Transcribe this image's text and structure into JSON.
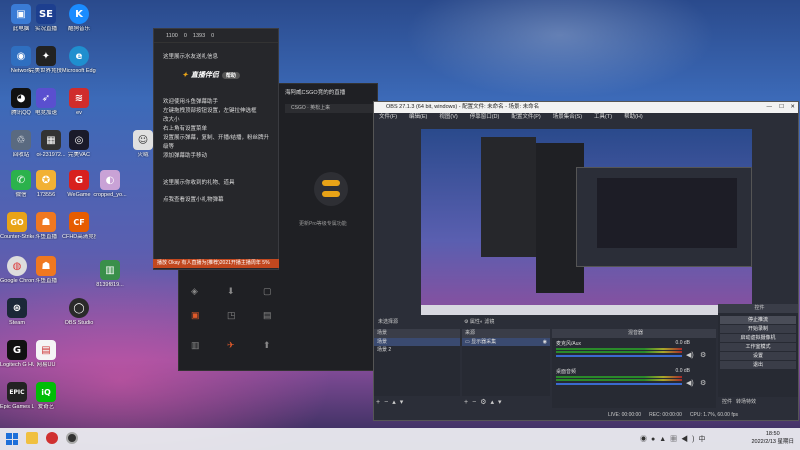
{
  "desktop": {
    "icons": [
      {
        "label": "此电脑",
        "glyph": "▣",
        "color": "#3a7bd5"
      },
      {
        "label": "实况直播",
        "glyph": "SE",
        "color": "#1d3f8f"
      },
      {
        "label": "酷狗音乐",
        "glyph": "K",
        "color": "#1a8cff"
      },
      {
        "label": "Network",
        "glyph": "◉",
        "color": "#2f6fc0"
      },
      {
        "label": "完美世界竞技平台",
        "glyph": "✦",
        "color": "#222222"
      },
      {
        "label": "Microsoft Edge",
        "glyph": "e",
        "color": "#1f8fcf"
      },
      {
        "label": "腾讯QQ",
        "glyph": "◕",
        "color": "#111111"
      },
      {
        "label": "电竞加速",
        "glyph": "➶",
        "color": "#5a4fcf"
      },
      {
        "label": "ev",
        "glyph": "≋",
        "color": "#d02c2c"
      },
      {
        "label": "回收站",
        "glyph": "♲",
        "color": "#5a6a80"
      },
      {
        "label": "oi-231972...",
        "glyph": "▦",
        "color": "#333333"
      },
      {
        "label": "完美VAC",
        "glyph": "◎",
        "color": "#1a1a2a"
      },
      {
        "label": "火绒",
        "glyph": "☺",
        "color": "#e0e0e0"
      },
      {
        "label": "微信",
        "glyph": "✆",
        "color": "#2bb24c"
      },
      {
        "label": "173556",
        "glyph": "✪",
        "color": "#f2b134"
      },
      {
        "label": "WeGame",
        "glyph": "G",
        "color": "#d8201e"
      },
      {
        "label": "cropped_yo...",
        "glyph": "◐",
        "color": "#c9a2d6"
      },
      {
        "label": "Counter-Strike: GO",
        "glyph": "GO",
        "color": "#e8a317"
      },
      {
        "label": "斗鱼直播",
        "glyph": "☗",
        "color": "#f07820"
      },
      {
        "label": "CFHD高清竞技大区",
        "glyph": "CF",
        "color": "#e65c00"
      },
      {
        "label": "Google Chrome",
        "glyph": "◍",
        "color": "#dddddd"
      },
      {
        "label": "斗鱼直播",
        "glyph": "☗",
        "color": "#f07820"
      },
      {
        "label": "8139f819...",
        "glyph": "▥",
        "color": "#3a8f4a"
      },
      {
        "label": "Steam",
        "glyph": "⊛",
        "color": "#1b2838"
      },
      {
        "label": "OBS Studio",
        "glyph": "◯",
        "color": "#2a2a2a"
      },
      {
        "label": "Logitech G HUB",
        "glyph": "G",
        "color": "#111111"
      },
      {
        "label": "网易UU",
        "glyph": "▤",
        "color": "#f5f5f5"
      },
      {
        "label": "Epic Games Launcher",
        "glyph": "EPIC",
        "color": "#222222"
      },
      {
        "label": "爱奇艺",
        "glyph": "iQ",
        "color": "#00be06"
      }
    ]
  },
  "helper": {
    "stats": [
      "1100",
      "0",
      "1393",
      "0"
    ],
    "line1": "这里展示水友送礼信息",
    "brand": "直播伴侣",
    "brand_badge": "帮助",
    "info": [
      "欢迎使用斗鱼弹幕助手",
      "左键拖拽顶部按钮设置，左键拉伸选框",
      "改大小",
      "右上角有设置菜单",
      "设置展示弹幕，复制、开播/结播，粉丝牌升",
      "级等",
      "添加弹幕助手移动"
    ],
    "line_gift": "这里展示你收到的礼物、道具",
    "line_hint": "点我查看设置小礼物弹幕"
  },
  "main_window": {
    "title": "海阿威CSGO竞的的直播",
    "control_label": "CSGO · 英松上来",
    "center_caption": "更新Pro等级专属功能"
  },
  "banner": "播放 Okay 有人直播为(推荐)2021开播主播周年 5%",
  "obs": {
    "title": "OBS 27.1.3 (64 bit, windows) - 配置文件: 未命名 - 场景: 未命名",
    "menu": [
      "文件(F)",
      "编辑(E)",
      "视图(V)",
      "停靠窗口(D)",
      "配置文件(P)",
      "场景集合(S)",
      "工具(T)",
      "帮助(H)"
    ],
    "scene_label": "未选择源",
    "props_btn": "属性",
    "filter_btn": "滤镜",
    "docks": {
      "scenes": {
        "header": "场景",
        "items": [
          "场景",
          "场景 2"
        ]
      },
      "sources": {
        "header": "来源",
        "items": [
          "显示器采集"
        ]
      },
      "mixer": {
        "header": "混音器",
        "channels": [
          {
            "name": "麦克风/Aux",
            "db": "0.0 dB"
          },
          {
            "name": "桌面音频",
            "db": "0.0 dB"
          }
        ]
      },
      "controls": {
        "header": "控件",
        "buttons": [
          "停止推流",
          "开始录制",
          "启动虚拟摄像机",
          "工作室模式",
          "设置",
          "退出"
        ]
      },
      "transitions": {
        "tab1": "控件",
        "tab2": "转场特效"
      }
    },
    "status": [
      "LIVE: 00:00:00",
      "REC: 00:00:00",
      "CPU: 1.7%, 60.00 fps"
    ]
  },
  "taskbar": {
    "time": "18:50",
    "date": "2022/2/13 星期日"
  }
}
